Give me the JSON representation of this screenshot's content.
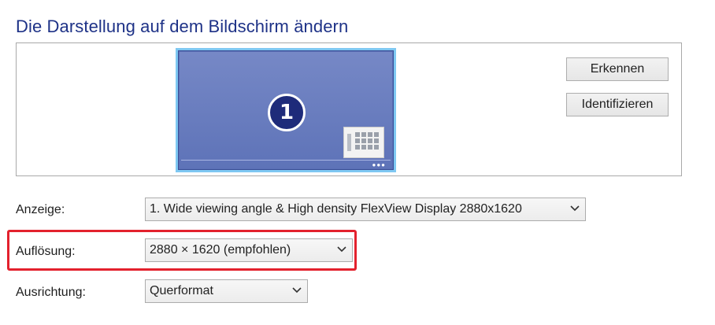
{
  "page": {
    "title": "Die Darstellung auf dem Bildschirm ändern"
  },
  "preview": {
    "monitor_number": "1",
    "buttons": {
      "detect": "Erkennen",
      "identify": "Identifizieren"
    }
  },
  "settings": {
    "display": {
      "label": "Anzeige:",
      "value": "1. Wide viewing angle & High density FlexView Display 2880x1620"
    },
    "resolution": {
      "label": "Auflösung:",
      "value": "2880 × 1620 (empfohlen)"
    },
    "orientation": {
      "label": "Ausrichtung:",
      "value": "Querformat"
    }
  },
  "colors": {
    "title": "#1e3287",
    "highlight": "#e3212d",
    "monitor_bg": "#5e73b8",
    "monitor_border": "#7fc8f2"
  },
  "icons": {
    "monitor": "monitor-icon",
    "start_tile": "start-screen-icon",
    "chevron": "chevron-down-icon"
  }
}
